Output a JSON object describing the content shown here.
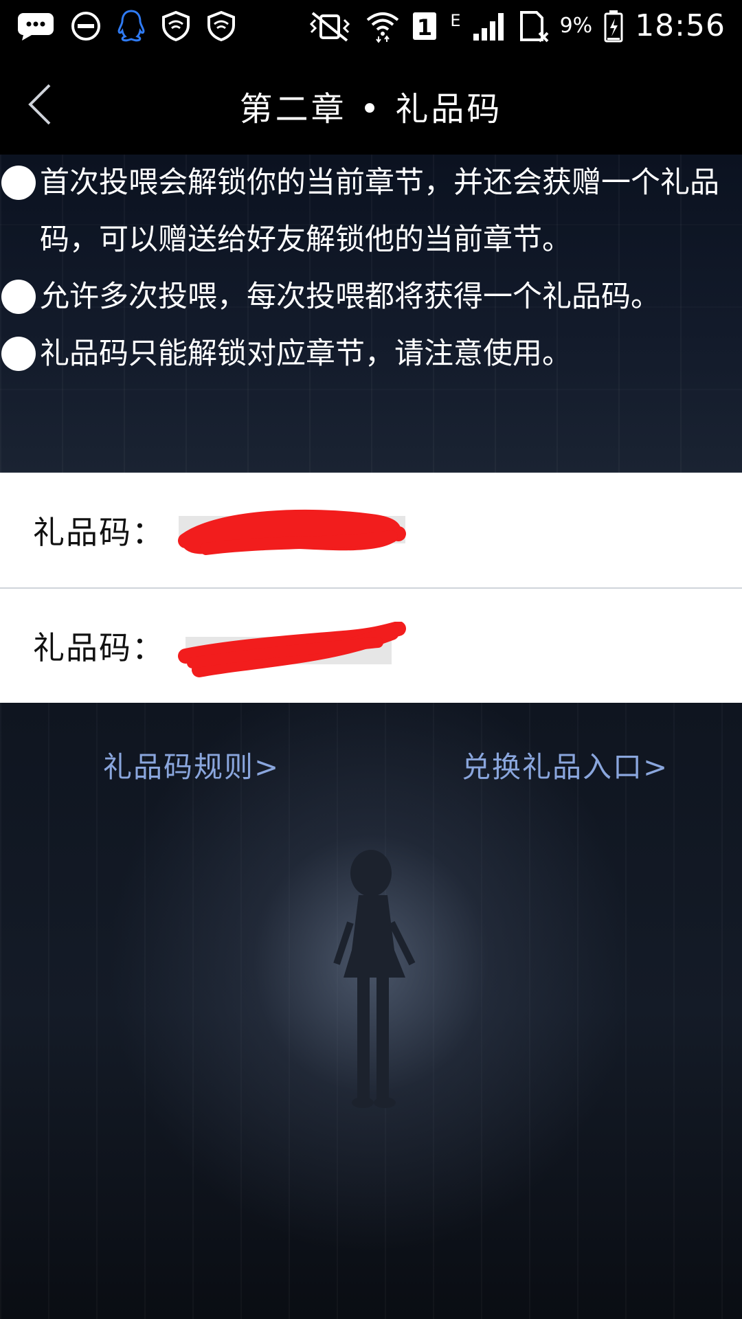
{
  "status_bar": {
    "icons": [
      "message-icon",
      "do-not-disturb-icon",
      "qq-penguin-icon",
      "shield-icon",
      "shield-icon",
      "vibrate-icon",
      "wifi-icon",
      "sim1-icon",
      "signal-icon",
      "sim-slot-icon"
    ],
    "sim_label": "1",
    "network_label": "E",
    "battery_percent": "9%",
    "time": "18:56"
  },
  "header": {
    "title": "第二章 • 礼品码"
  },
  "rules": [
    {
      "text": "首次投喂会解锁你的当前章节，并还会获赠一个礼品码，可以赠送给好友解锁他的当前章节。"
    },
    {
      "text": "允许多次投喂，每次投喂都将获得一个礼品码。"
    },
    {
      "text": "礼品码只能解锁对应章节，请注意使用。"
    }
  ],
  "codes": [
    {
      "label": "礼品码："
    },
    {
      "label": "礼品码："
    }
  ],
  "links": {
    "rules_label": "礼品码规则>",
    "redeem_label": "兑换礼品入口>"
  },
  "colors": {
    "link": "#8aa6dd",
    "redaction": "#f21d1d",
    "header_bg": "#000000"
  }
}
